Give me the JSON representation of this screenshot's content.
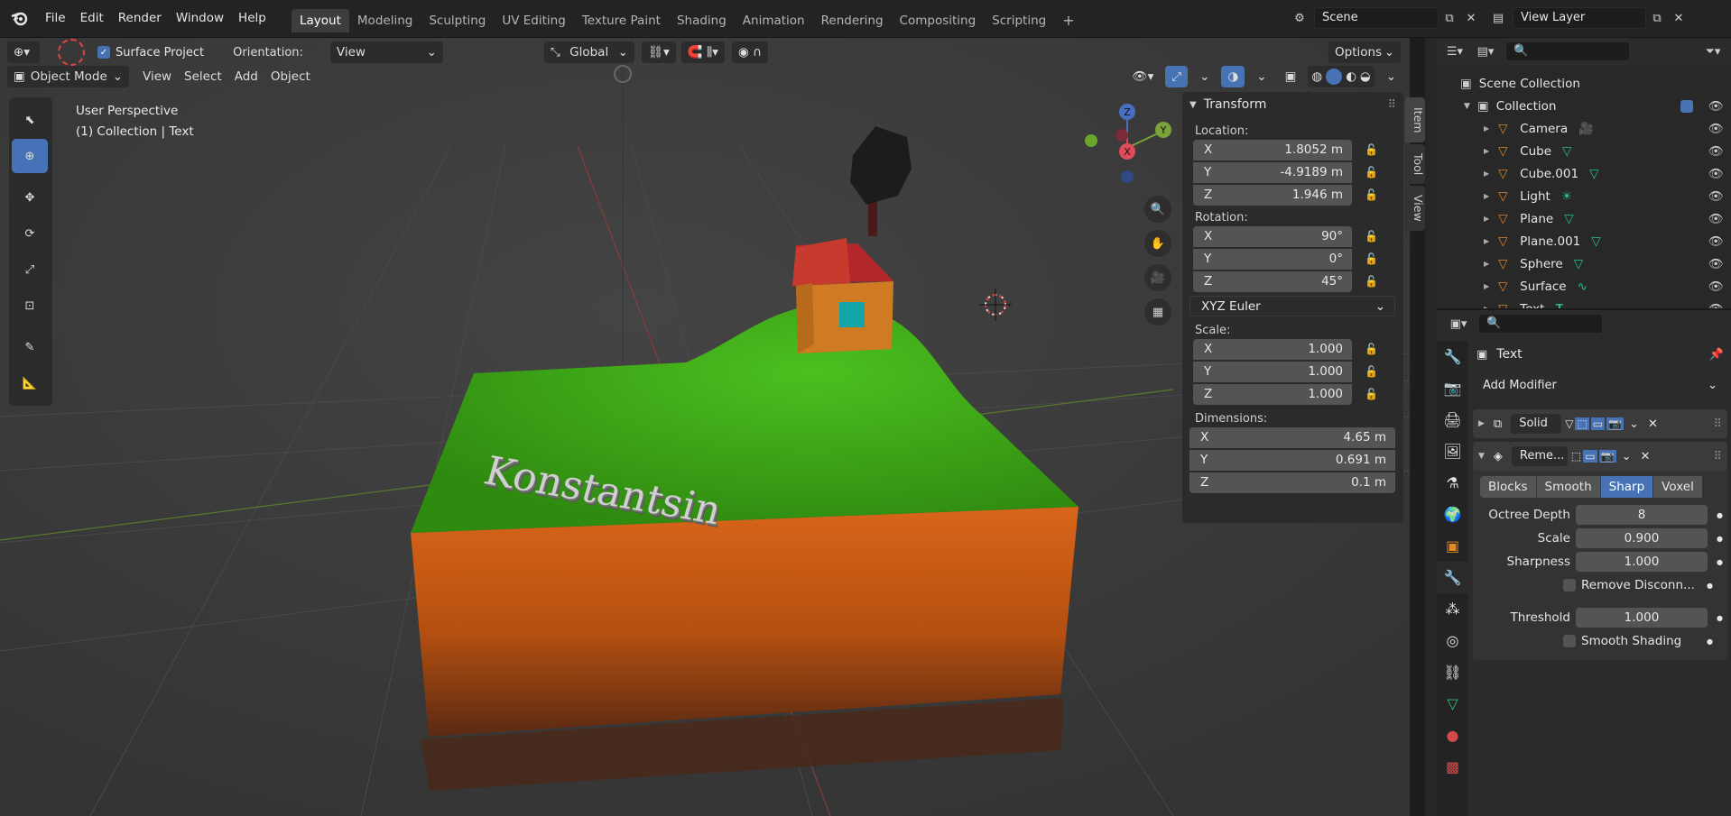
{
  "app": {
    "logo_icon": "blender-logo"
  },
  "menu": [
    "File",
    "Edit",
    "Render",
    "Window",
    "Help"
  ],
  "workspaces": [
    "Layout",
    "Modeling",
    "Sculpting",
    "UV Editing",
    "Texture Paint",
    "Shading",
    "Animation",
    "Rendering",
    "Compositing",
    "Scripting"
  ],
  "workspace_add": "+",
  "scene": {
    "name": "Scene"
  },
  "view_layer": {
    "name": "View Layer"
  },
  "tool_header": {
    "surface_project_label": "Surface Project",
    "surface_project_checked": true,
    "orientation_label": "Orientation:",
    "orientation_value": "View",
    "transform_orientation": "Global",
    "options_label": "Options"
  },
  "viewport_header": {
    "mode": "Object Mode",
    "menus": [
      "View",
      "Select",
      "Add",
      "Object"
    ]
  },
  "viewport_overlay": {
    "perspective": "User Perspective",
    "collection_info": "(1) Collection | Text",
    "scene_text": "Konstantsin"
  },
  "n_panel": {
    "title": "Transform",
    "tabs": [
      "Item",
      "Tool",
      "View"
    ],
    "location_label": "Location:",
    "location": [
      {
        "axis": "X",
        "value": "1.8052 m"
      },
      {
        "axis": "Y",
        "value": "-4.9189 m"
      },
      {
        "axis": "Z",
        "value": "1.946 m"
      }
    ],
    "rotation_label": "Rotation:",
    "rotation": [
      {
        "axis": "X",
        "value": "90°"
      },
      {
        "axis": "Y",
        "value": "0°"
      },
      {
        "axis": "Z",
        "value": "45°"
      }
    ],
    "rotation_mode": "XYZ Euler",
    "scale_label": "Scale:",
    "scale": [
      {
        "axis": "X",
        "value": "1.000"
      },
      {
        "axis": "Y",
        "value": "1.000"
      },
      {
        "axis": "Z",
        "value": "1.000"
      }
    ],
    "dimensions_label": "Dimensions:",
    "dimensions": [
      {
        "axis": "X",
        "value": "4.65 m"
      },
      {
        "axis": "Y",
        "value": "0.691 m"
      },
      {
        "axis": "Z",
        "value": "0.1 m"
      }
    ]
  },
  "gizmo": {
    "x": "X",
    "y": "Y",
    "z": "Z"
  },
  "outliner": {
    "root": "Scene Collection",
    "collection": "Collection",
    "items": [
      {
        "name": "Camera",
        "icon": "camera-icon"
      },
      {
        "name": "Cube",
        "icon": "mesh-icon"
      },
      {
        "name": "Cube.001",
        "icon": "mesh-icon"
      },
      {
        "name": "Light",
        "icon": "light-icon"
      },
      {
        "name": "Plane",
        "icon": "mesh-icon"
      },
      {
        "name": "Plane.001",
        "icon": "mesh-icon"
      },
      {
        "name": "Sphere",
        "icon": "mesh-icon"
      },
      {
        "name": "Surface",
        "icon": "curve-icon"
      },
      {
        "name": "Text",
        "icon": "text-icon"
      }
    ]
  },
  "properties": {
    "object_name": "Text",
    "add_modifier": "Add Modifier",
    "modifiers": [
      {
        "name": "Solid"
      },
      {
        "name": "Reme..."
      }
    ],
    "remesh_modes": [
      "Blocks",
      "Smooth",
      "Sharp",
      "Voxel"
    ],
    "remesh_mode_selected": "Sharp",
    "octree_depth_label": "Octree Depth",
    "octree_depth": "8",
    "scale_label": "Scale",
    "scale": "0.900",
    "sharpness_label": "Sharpness",
    "sharpness": "1.000",
    "remove_disconnected_label": "Remove Disconn...",
    "threshold_label": "Threshold",
    "threshold": "1.000",
    "smooth_shading_label": "Smooth Shading"
  },
  "colors": {
    "accent": "#4772b3",
    "grass": "#3fa11a",
    "soil": "#c05a10",
    "roof": "#b02a2a",
    "house": "#d9822b"
  }
}
